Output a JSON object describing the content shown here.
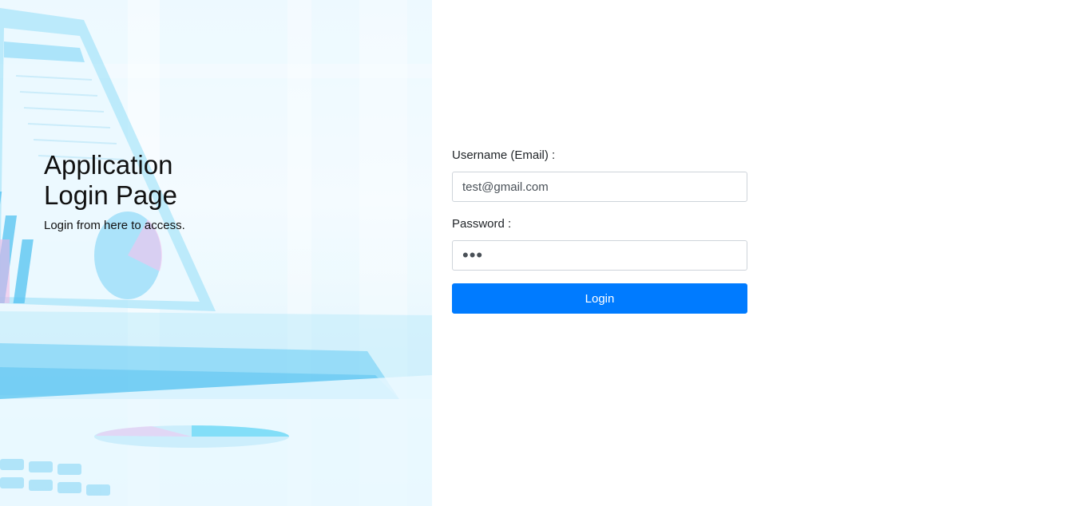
{
  "hero": {
    "title": "Application Login Page",
    "subtitle": "Login from here to access."
  },
  "form": {
    "username_label": "Username (Email) :",
    "username_value": "test@gmail.com",
    "password_label": "Password :",
    "password_value": "123",
    "login_button": "Login"
  },
  "colors": {
    "primary": "#007bff",
    "hero_tint": "#5ccbf5"
  }
}
